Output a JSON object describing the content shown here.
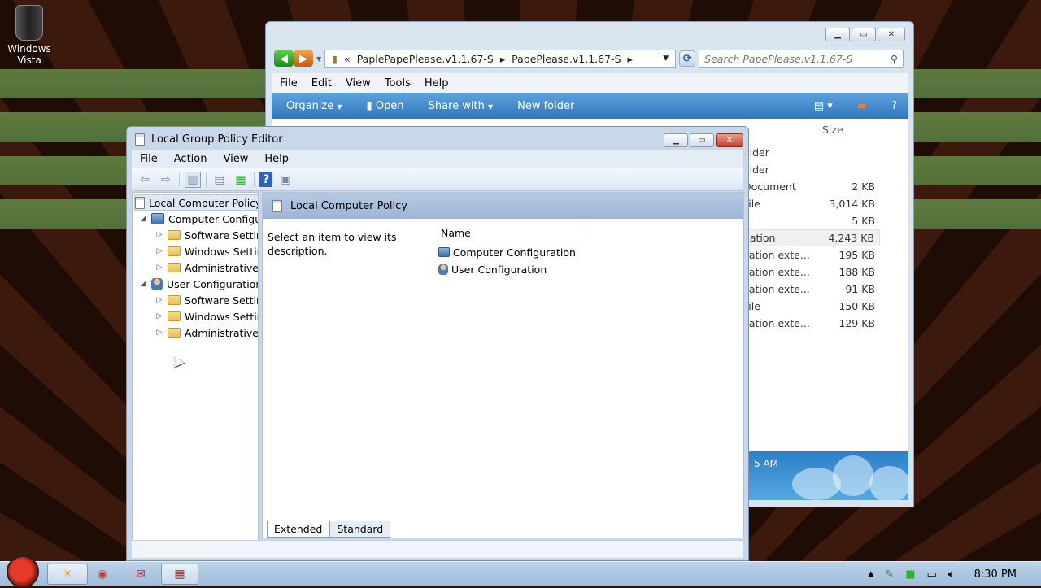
{
  "desktop": {
    "recycle_bin_label": "Windows Vista"
  },
  "explorer": {
    "address": {
      "overflow": "«",
      "crumb1": "PaplePapePlease.v1.1.67-S",
      "crumb2": "PapePlease.v1.1.67-S"
    },
    "search_placeholder": "Search PapePlease.v1.1.67-S",
    "menu": [
      "File",
      "Edit",
      "View",
      "Tools",
      "Help"
    ],
    "commands": {
      "organize": "Organize",
      "open": "Open",
      "share_with": "Share with",
      "new_folder": "New folder"
    },
    "size_header": "Size",
    "files": [
      {
        "type": "older",
        "size": ""
      },
      {
        "type": "older",
        "size": ""
      },
      {
        "type": "Document",
        "size": "2 KB"
      },
      {
        "type": "File",
        "size": "3,014 KB"
      },
      {
        "type": "",
        "size": "5 KB"
      },
      {
        "type": "cation",
        "size": "4,243 KB"
      },
      {
        "type": "cation exte...",
        "size": "195 KB"
      },
      {
        "type": "cation exte...",
        "size": "188 KB"
      },
      {
        "type": "cation exte...",
        "size": "91 KB"
      },
      {
        "type": "File",
        "size": "150 KB"
      },
      {
        "type": "cation exte...",
        "size": "129 KB"
      }
    ],
    "details_text": "5 AM"
  },
  "gpedit": {
    "title": "Local Group Policy Editor",
    "menu": [
      "File",
      "Action",
      "View",
      "Help"
    ],
    "tree": {
      "root": "Local Computer Policy",
      "computer": "Computer Configura",
      "computer_children": [
        "Software Setting",
        "Windows Setting",
        "Administrative Te"
      ],
      "user": "User Configuration",
      "user_children": [
        "Software Setting",
        "Windows Setting",
        "Administrative Te"
      ]
    },
    "banner_title": "Local Computer Policy",
    "description": "Select an item to view its description.",
    "list_header": "Name",
    "items": [
      "Computer Configuration",
      "User Configuration"
    ],
    "tabs": [
      "Extended",
      "Standard"
    ]
  },
  "taskbar": {
    "time": "8:30 PM"
  }
}
